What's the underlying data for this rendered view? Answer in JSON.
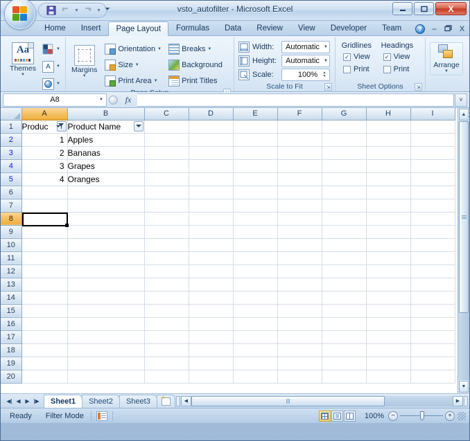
{
  "window": {
    "title": "vsto_autofilter - Microsoft Excel",
    "office_button": "office-orb",
    "minimize": "–",
    "maximize": "□",
    "close": "X"
  },
  "quick_access": {
    "save": "Save",
    "undo": "Undo",
    "redo": "Redo",
    "customize": "Customize Quick Access Toolbar"
  },
  "ribbon": {
    "tabs": [
      {
        "label": "Home",
        "active": false
      },
      {
        "label": "Insert",
        "active": false
      },
      {
        "label": "Page Layout",
        "active": true
      },
      {
        "label": "Formulas",
        "active": false
      },
      {
        "label": "Data",
        "active": false
      },
      {
        "label": "Review",
        "active": false
      },
      {
        "label": "View",
        "active": false
      },
      {
        "label": "Developer",
        "active": false
      },
      {
        "label": "Team",
        "active": false
      }
    ],
    "help": "?",
    "doc_minimize": "–",
    "doc_restore": "❐",
    "doc_close": "X",
    "groups": {
      "themes": {
        "label": "Themes",
        "big_button": "Themes",
        "colors": "Colors",
        "fonts": "A",
        "effects": "Effects"
      },
      "page_setup": {
        "label": "Page Setup",
        "margins": "Margins",
        "orientation": "Orientation",
        "size": "Size",
        "print_area": "Print Area",
        "breaks": "Breaks",
        "background": "Background",
        "print_titles": "Print Titles"
      },
      "scale_to_fit": {
        "label": "Scale to Fit",
        "width_label": "Width:",
        "width_value": "Automatic",
        "height_label": "Height:",
        "height_value": "Automatic",
        "scale_label": "Scale:",
        "scale_value": "100%"
      },
      "sheet_options": {
        "label": "Sheet Options",
        "gridlines_header": "Gridlines",
        "headings_header": "Headings",
        "gridlines_view": "View",
        "gridlines_print": "Print",
        "headings_view": "View",
        "headings_print": "Print",
        "gridlines_view_checked": true,
        "gridlines_print_checked": false,
        "headings_view_checked": true,
        "headings_print_checked": false,
        "check_glyph": "✓"
      },
      "arrange": {
        "label": "Arrange",
        "button": "Arrange"
      }
    }
  },
  "formula_bar": {
    "name_box": "A8",
    "fx_label": "fx",
    "formula_value": "",
    "expand": "˅"
  },
  "sheet": {
    "columns": [
      "A",
      "B",
      "C",
      "D",
      "E",
      "F",
      "G",
      "H",
      "I"
    ],
    "selected_column": "A",
    "selected_row": 8,
    "selected_cell": "A8",
    "rows": [
      1,
      2,
      3,
      4,
      5,
      6,
      7,
      8,
      9,
      10,
      11,
      12,
      13,
      14,
      15,
      16,
      17,
      18,
      19,
      20
    ],
    "filtered_rows": [
      2,
      3,
      4,
      5
    ],
    "cells": [
      {
        "row": 1,
        "A": "Produc",
        "B": "Product Name",
        "header": true
      },
      {
        "row": 2,
        "A": "1",
        "B": "Apples"
      },
      {
        "row": 3,
        "A": "2",
        "B": "Bananas"
      },
      {
        "row": 4,
        "A": "3",
        "B": "Grapes"
      },
      {
        "row": 5,
        "A": "4",
        "B": "Oranges"
      }
    ],
    "filter_a": "filter-active-icon",
    "filter_b": "filter-dropdown-icon"
  },
  "sheet_tabs": {
    "first": "⏮",
    "prev": "◀",
    "next": "▶",
    "last": "⏭",
    "tabs": [
      {
        "label": "Sheet1",
        "active": true
      },
      {
        "label": "Sheet2",
        "active": false
      },
      {
        "label": "Sheet3",
        "active": false
      }
    ],
    "insert_sheet": "Insert Worksheet"
  },
  "status_bar": {
    "mode": "Ready",
    "filter_mode": "Filter Mode",
    "macro_icon": "record-macro-icon",
    "views": [
      {
        "name": "normal-view",
        "active": true
      },
      {
        "name": "page-layout-view",
        "active": false
      },
      {
        "name": "page-break-preview",
        "active": false
      }
    ],
    "zoom": "100%",
    "zoom_out": "−",
    "zoom_in": "+"
  },
  "colors": {
    "accent": "#f5c063",
    "tab_active": "#fcfdfe",
    "filtered_row_text": "#1414e0",
    "titlebar": "#cddff2",
    "close_button": "#c23b24"
  }
}
